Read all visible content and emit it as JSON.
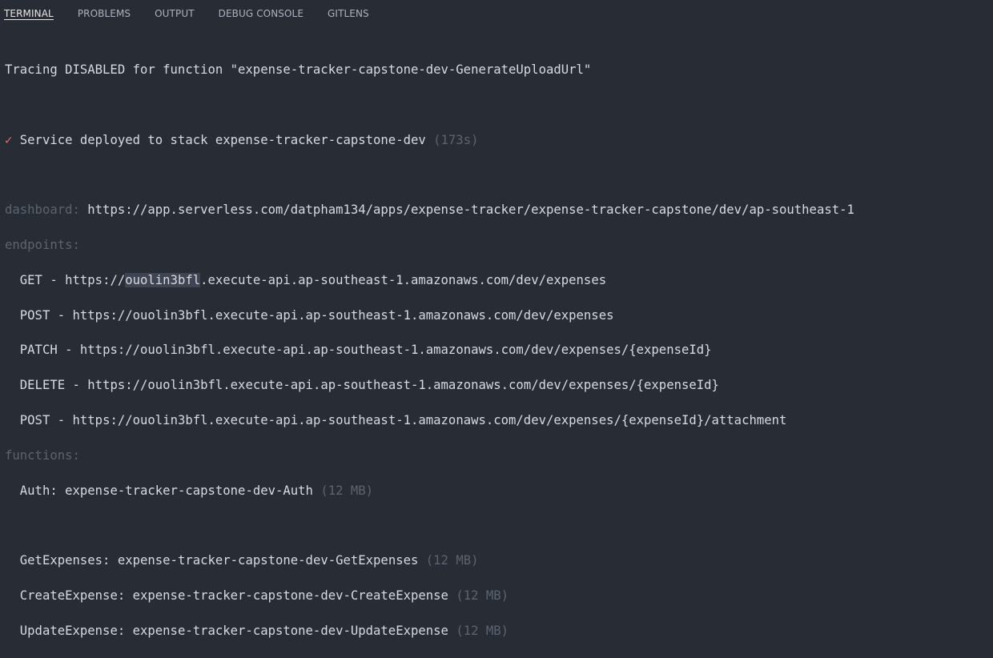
{
  "tabs": [
    {
      "label": "TERMINAL",
      "active": true
    },
    {
      "label": "PROBLEMS"
    },
    {
      "label": "OUTPUT"
    },
    {
      "label": "DEBUG CONSOLE"
    },
    {
      "label": "GITLENS"
    }
  ],
  "terminal": {
    "tracing_line": "Tracing DISABLED for function \"expense-tracker-capstone-dev-GenerateUploadUrl\"",
    "deploy": {
      "check": "✓",
      "message": "Service deployed to stack expense-tracker-capstone-dev",
      "duration": "(173s)"
    },
    "dashboard": {
      "label": "dashboard:",
      "url": "https://app.serverless.com/datpham134/apps/expense-tracker/expense-tracker-capstone/dev/ap-southeast-1"
    },
    "endpoints_label": "endpoints:",
    "endpoints": [
      {
        "method": "GET",
        "prefix": "https://",
        "highlight": "ouolin3bfl",
        "rest": ".execute-api.ap-southeast-1.amazonaws.com/dev/expenses"
      },
      {
        "method": "POST",
        "url": "https://ouolin3bfl.execute-api.ap-southeast-1.amazonaws.com/dev/expenses"
      },
      {
        "method": "PATCH",
        "url": "https://ouolin3bfl.execute-api.ap-southeast-1.amazonaws.com/dev/expenses/{expenseId}"
      },
      {
        "method": "DELETE",
        "url": "https://ouolin3bfl.execute-api.ap-southeast-1.amazonaws.com/dev/expenses/{expenseId}"
      },
      {
        "method": "POST",
        "url": "https://ouolin3bfl.execute-api.ap-southeast-1.amazonaws.com/dev/expenses/{expenseId}/attachment"
      }
    ],
    "functions_label": "functions:",
    "functions": [
      {
        "name": "Auth:",
        "value": "expense-tracker-capstone-dev-Auth",
        "size": "(12 MB)"
      },
      {
        "name": "GetExpenses:",
        "value": "expense-tracker-capstone-dev-GetExpenses",
        "size": "(12 MB)"
      },
      {
        "name": "CreateExpense:",
        "value": "expense-tracker-capstone-dev-CreateExpense",
        "size": "(12 MB)"
      },
      {
        "name": "UpdateExpense:",
        "value": "expense-tracker-capstone-dev-UpdateExpense",
        "size": "(12 MB)"
      }
    ]
  }
}
